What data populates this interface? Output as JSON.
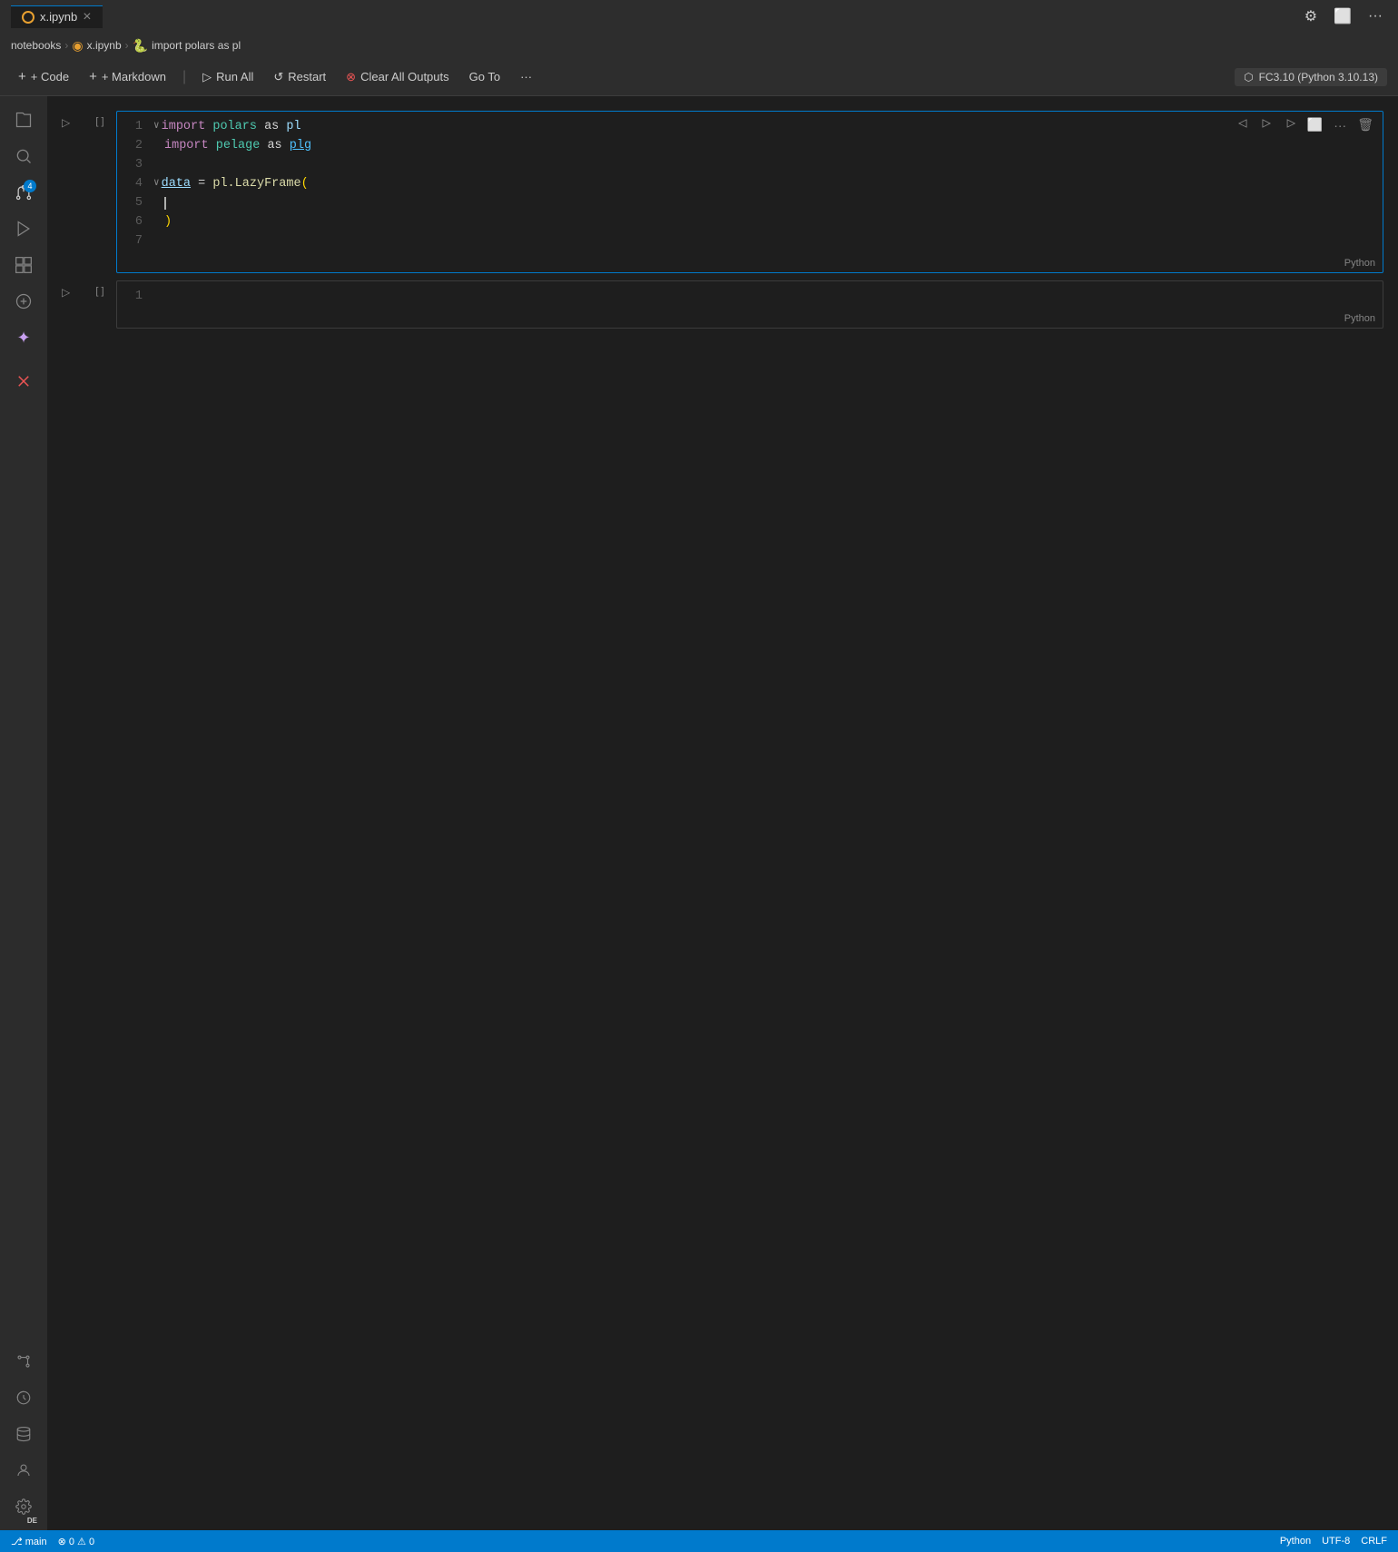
{
  "titleBar": {
    "tab": {
      "name": "x.ipynb",
      "icon": "notebook-icon",
      "close": "×"
    },
    "actions": [
      "⚙",
      "⬜",
      "..."
    ]
  },
  "breadcrumb": {
    "parts": [
      "notebooks",
      "x.ipynb",
      "import polars as pl"
    ]
  },
  "toolbar": {
    "add_code": "+ Code",
    "add_markdown": "+ Markdown",
    "run_all": "Run All",
    "restart": "Restart",
    "clear_outputs": "Clear All Outputs",
    "go_to": "Go To",
    "more": "...",
    "kernel": "FC3.10 (Python 3.10.13)"
  },
  "activityBar": {
    "items": [
      {
        "name": "explorer-icon",
        "symbol": "⬡",
        "active": false
      },
      {
        "name": "search-icon",
        "symbol": "🔍",
        "active": false
      },
      {
        "name": "source-control-icon",
        "symbol": "⎇",
        "active": true,
        "badge": "4"
      },
      {
        "name": "run-debug-icon",
        "symbol": "▷",
        "active": false
      },
      {
        "name": "extensions-icon",
        "symbol": "⊞",
        "active": false
      },
      {
        "name": "jupyter-icon",
        "symbol": "⬡",
        "active": false
      },
      {
        "name": "copilot-icon",
        "symbol": "✦",
        "active": false
      }
    ],
    "bottom": [
      {
        "name": "error-icon",
        "symbol": "✕"
      },
      {
        "name": "git-icon",
        "symbol": "⌨"
      },
      {
        "name": "history-icon",
        "symbol": "↺"
      },
      {
        "name": "extensions2-icon",
        "symbol": "❖"
      },
      {
        "name": "account-icon",
        "symbol": "👤"
      },
      {
        "name": "settings-icon",
        "symbol": "⚙",
        "label": "DE"
      }
    ]
  },
  "cells": [
    {
      "id": "cell1",
      "execution": "[ ]",
      "active": true,
      "lines": [
        {
          "num": 1,
          "tokens": [
            {
              "t": "kw",
              "v": "import"
            },
            {
              "t": "sp",
              "v": " "
            },
            {
              "t": "mod",
              "v": "polars"
            },
            {
              "t": "sp",
              "v": " "
            },
            {
              "t": "kw-as",
              "v": "as"
            },
            {
              "t": "sp",
              "v": " "
            },
            {
              "t": "alias",
              "v": "pl"
            }
          ],
          "collapsible": true
        },
        {
          "num": 2,
          "tokens": [
            {
              "t": "kw",
              "v": "import"
            },
            {
              "t": "sp",
              "v": " "
            },
            {
              "t": "mod",
              "v": "pelage"
            },
            {
              "t": "sp",
              "v": " "
            },
            {
              "t": "kw-as",
              "v": "as"
            },
            {
              "t": "sp",
              "v": " "
            },
            {
              "t": "alias-plg",
              "v": "plg"
            }
          ]
        },
        {
          "num": 3,
          "tokens": []
        },
        {
          "num": 4,
          "tokens": [
            {
              "t": "var-und",
              "v": "data"
            },
            {
              "t": "sp",
              "v": " "
            },
            {
              "t": "op",
              "v": "="
            },
            {
              "t": "sp",
              "v": " "
            },
            {
              "t": "attr",
              "v": "pl.LazyFrame"
            },
            {
              "t": "paren",
              "v": "("
            }
          ],
          "collapsible": true
        },
        {
          "num": 5,
          "tokens": [
            {
              "t": "cursor",
              "v": ""
            }
          ]
        },
        {
          "num": 6,
          "tokens": [
            {
              "t": "paren",
              "v": ")"
            }
          ]
        },
        {
          "num": 7,
          "tokens": []
        }
      ],
      "lang": "Python"
    },
    {
      "id": "cell2",
      "execution": "[ ]",
      "active": false,
      "lines": [
        {
          "num": 1,
          "tokens": []
        }
      ],
      "lang": "Python"
    }
  ],
  "statusBar": {
    "left": [],
    "right": []
  }
}
